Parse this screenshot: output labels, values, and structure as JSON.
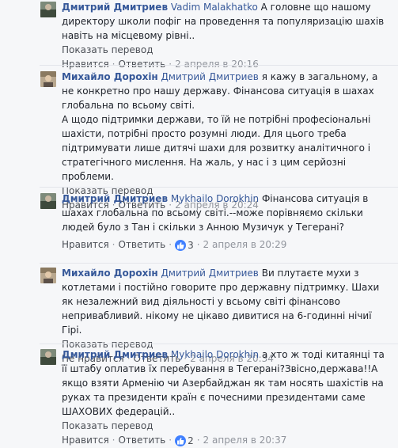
{
  "labels": {
    "translate": "Показать перевод",
    "like": "Нравится",
    "unlike": "Не нравится",
    "reply": "Ответить",
    "separator": "·"
  },
  "comments": [
    {
      "author": "Дмитрий Дмитриев",
      "mention": "Vadim Malakhatko",
      "text": " А головне що нашому директору школи пофіг на проведення та популяризацію шахів навіть на місцевому рівні..",
      "like_label": "Нравится",
      "reactions": "",
      "timestamp": "2 апреля в 20:16"
    },
    {
      "author": "Михайло Дорохін",
      "mention": "Дмитрий Дмитриев",
      "text": " я кажу в загальному, а не конкретно про нашу державу. Фінансова ситуація в шахах глобальна по всьому світі.\nА щодо підтримки держави, то їй не потрібні професіональні шахісти, потрібні просто розумні люди. Для цього треба підтримувати лише дитячі шахи для розвитку аналітичного і стратегічного мислення. На жаль, у нас і з цим серйозні проблеми.",
      "like_label": "Нравится",
      "reactions": "",
      "timestamp": "2 апреля в 20:24"
    },
    {
      "author": "Дмитрий Дмитриев",
      "mention": "Mykhailo Dorokhin",
      "text": " Фінансова ситуація в шахах глобальна по всьому світі.--може порівняємо скільки людей було з Тан і скільки з Анною Музичук у Тегерані?",
      "like_label": "Нравится",
      "reactions": "3",
      "timestamp": "2 апреля в 20:29"
    },
    {
      "author": "Михайло Дорохін",
      "mention": "Дмитрий Дмитриев",
      "text": " Ви плутаєте мухи з котлетами і постійно говорите про державну підтримку. Шахи як незалежний вид діяльності у всьому світі фінансово непривабливий. нікому не цікаво дивитися на 6-годинні нічиї Гірі.",
      "like_label": "Не нравится",
      "reactions": "",
      "timestamp": "2 апреля в 20:34"
    },
    {
      "author": "Дмитрий Дмитриев",
      "mention": "Mykhailo Dorokhin",
      "text": " а хто ж тоді китаянці та її штабу оплатив їх перебування в Тегерані?Звісно,держава!!А якщо взяти Арменію чи Азербайджан як там носять шахістів на руках та президенти країн є почесними президентами саме ШАХОВИХ федерацій..",
      "like_label": "Нравится",
      "reactions": "2",
      "timestamp": "2 апреля в 20:37"
    }
  ],
  "colors": {
    "link": "#365899",
    "meta": "#90949c",
    "reaction": "#4080ff",
    "background": "#f6f7f9"
  },
  "icons": {
    "reaction": "thumbs-up-icon"
  }
}
